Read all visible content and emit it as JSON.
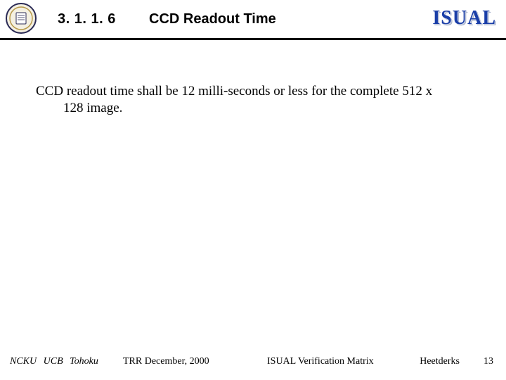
{
  "header": {
    "section_number": "3. 1. 1. 6",
    "title": "CCD Readout Time",
    "logo_text": "ISUAL"
  },
  "body": {
    "line1": "CCD readout time shall be 12 milli-seconds or less for the complete 512 x",
    "line2": "128 image."
  },
  "footer": {
    "orgs": "NCKU   UCB   Tohoku",
    "center1": "TRR   December,  2000",
    "center2": "ISUAL Verification Matrix",
    "author": "Heetderks",
    "page": "13"
  }
}
